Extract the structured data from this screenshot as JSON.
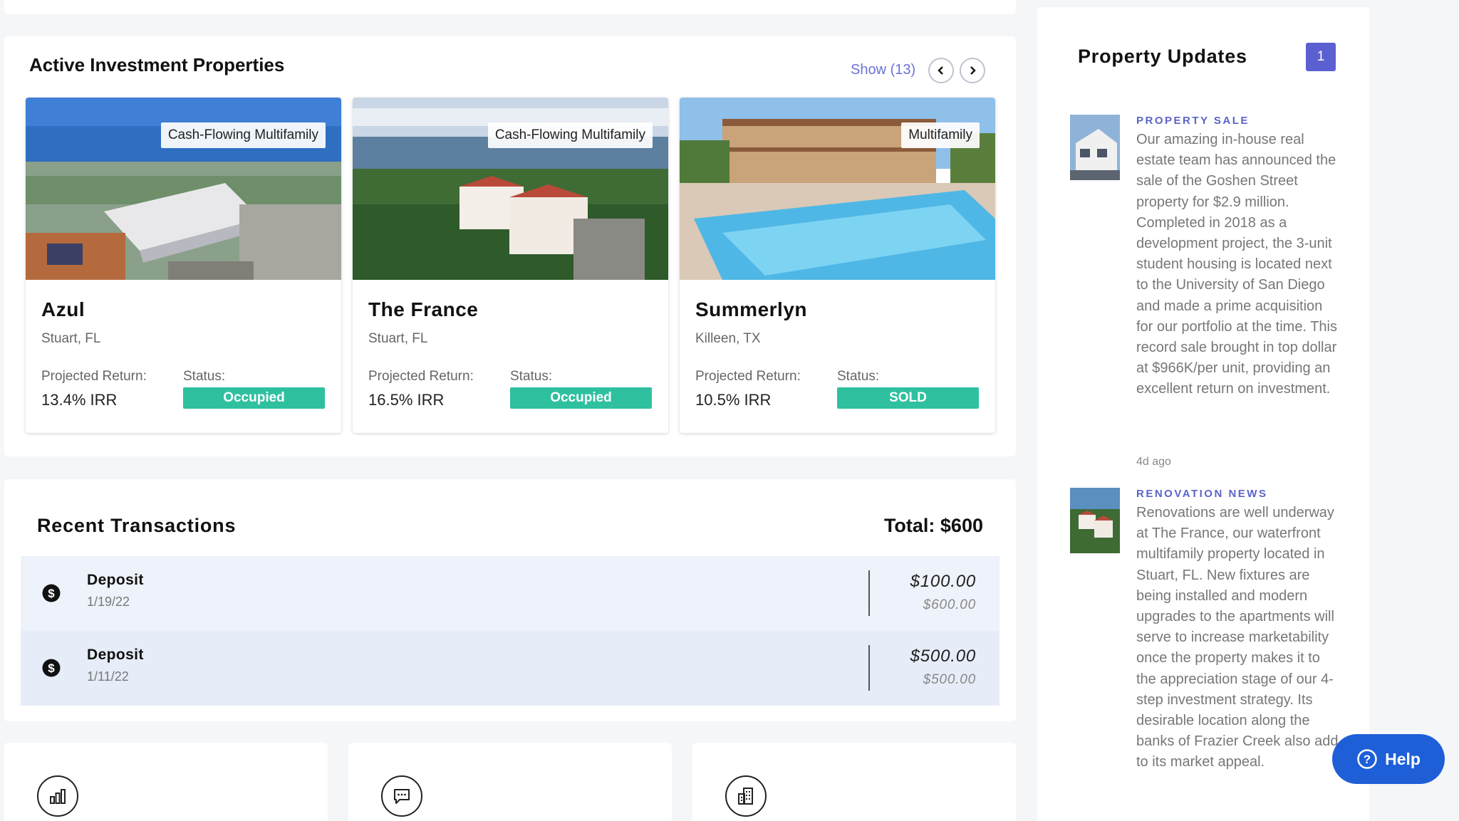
{
  "properties": {
    "title": "Active Investment Properties",
    "show_label": "Show (13)",
    "cards": [
      {
        "name": "Azul",
        "location": "Stuart, FL",
        "tag": "Cash-Flowing Multifamily",
        "return_label": "Projected Return:",
        "return_value": "13.4% IRR",
        "status_label": "Status:",
        "status": "Occupied"
      },
      {
        "name": "The France",
        "location": "Stuart, FL",
        "tag": "Cash-Flowing Multifamily",
        "return_label": "Projected Return:",
        "return_value": "16.5% IRR",
        "status_label": "Status:",
        "status": "Occupied"
      },
      {
        "name": "Summerlyn",
        "location": "Killeen, TX",
        "tag": "Multifamily",
        "return_label": "Projected Return:",
        "return_value": "10.5% IRR",
        "status_label": "Status:",
        "status": "SOLD"
      }
    ]
  },
  "transactions": {
    "title": "Recent Transactions",
    "total": "Total: $600",
    "rows": [
      {
        "type": "Deposit",
        "date": "1/19/22",
        "amount": "$100.00",
        "balance": "$600.00",
        "icon": "dollar-circle-icon"
      },
      {
        "type": "Deposit",
        "date": "1/11/22",
        "amount": "$500.00",
        "balance": "$500.00",
        "icon": "dollar-circle-icon"
      }
    ]
  },
  "tiles": [
    {
      "icon": "bar-chart-icon"
    },
    {
      "icon": "chat-bubble-icon"
    },
    {
      "icon": "building-icon"
    }
  ],
  "updates": {
    "title": "Property Updates",
    "badge": "1",
    "items": [
      {
        "category": "PROPERTY SALE",
        "text": "Our amazing in-house real estate team has announced the sale of the Goshen Street property for $2.9 million. Completed in 2018 as a development project, the 3-unit student housing is located next to the University of San Diego and made a prime acquisition for our portfolio at the time. This record sale brought in top dollar at $966K/per unit, providing an excellent return on investment.",
        "time": "4d ago"
      },
      {
        "category": "RENOVATION NEWS",
        "text": "Renovations are well underway at The France, our waterfront multifamily property located in Stuart, FL. New fixtures are being installed and modern upgrades to the apartments will serve to increase marketability once the property makes it to the appreciation stage of our 4-step investment strategy. Its desirable location along the banks of Frazier Creek also add to its market appeal."
      }
    ]
  },
  "help": {
    "label": "Help"
  },
  "colors": {
    "accent": "#5b60d1",
    "status_green": "#2fc0a0",
    "help_blue": "#1e5fd8",
    "link": "#6a73d6"
  }
}
